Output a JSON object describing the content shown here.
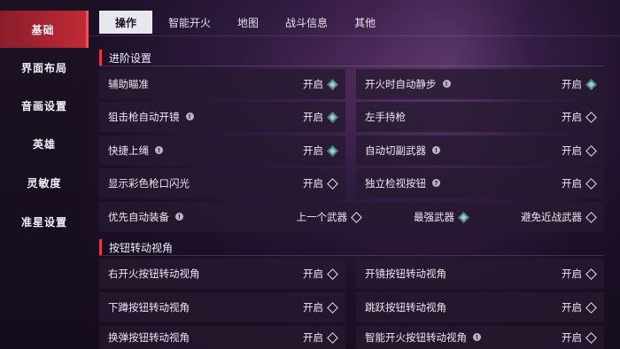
{
  "sidebar": {
    "items": [
      {
        "label": "基础",
        "active": true
      },
      {
        "label": "界面布局",
        "active": false
      },
      {
        "label": "音画设置",
        "active": false
      },
      {
        "label": "英雄",
        "active": false
      },
      {
        "label": "灵敏度",
        "active": false
      },
      {
        "label": "准星设置",
        "active": false
      }
    ]
  },
  "tabs": [
    {
      "label": "操作",
      "active": true
    },
    {
      "label": "智能开火",
      "active": false
    },
    {
      "label": "地图",
      "active": false
    },
    {
      "label": "战斗信息",
      "active": false
    },
    {
      "label": "其他",
      "active": false
    }
  ],
  "sections": {
    "advanced": {
      "title": "进阶设置",
      "rows": {
        "aim_assist": {
          "label": "辅助瞄准",
          "value": "开启",
          "on": true
        },
        "auto_slow": {
          "label": "开火时自动静步",
          "value": "开启",
          "on": true
        },
        "sniper_scope": {
          "label": "狙击枪自动开镜",
          "value": "开启",
          "on": true
        },
        "left_hand": {
          "label": "左手持枪",
          "value": "开启",
          "on": false
        },
        "quick_rope": {
          "label": "快捷上绳",
          "value": "开启",
          "on": true
        },
        "auto_switch": {
          "label": "自动切副武器",
          "value": "开启",
          "on": false
        },
        "muzzle_flash": {
          "label": "显示彩色枪口闪光",
          "value": "开启",
          "on": false
        },
        "inspect_button": {
          "label": "独立检视按钮",
          "value": "开启",
          "on": false
        },
        "auto_equip": {
          "label": "优先自动装备",
          "options": [
            {
              "label": "上一个武器",
              "on": false
            },
            {
              "label": "最强武器",
              "on": true
            },
            {
              "label": "避免近战武器",
              "on": false
            }
          ]
        }
      }
    },
    "button_view": {
      "title": "按钮转动视角",
      "rows": {
        "right_fire": {
          "label": "右开火按钮转动视角",
          "value": "开启",
          "on": false
        },
        "scope_btn": {
          "label": "开镜按钮转动视角",
          "value": "开启",
          "on": false
        },
        "crouch_btn": {
          "label": "下蹲按钮转动视角",
          "value": "开启",
          "on": false
        },
        "jump_btn": {
          "label": "跳跃按钮转动视角",
          "value": "开启",
          "on": false
        },
        "reload_btn": {
          "label": "换弹按钮转动视角",
          "value": "开启",
          "on": false
        },
        "smart_fire_btn": {
          "label": "智能开火按钮转动视角",
          "value": "开启",
          "on": false
        }
      }
    }
  }
}
